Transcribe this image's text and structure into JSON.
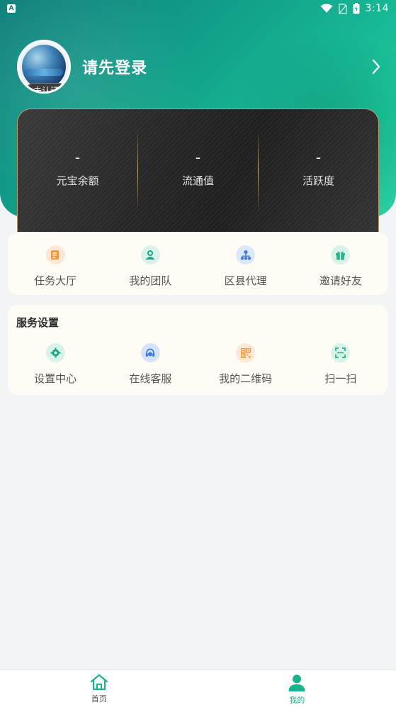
{
  "status_bar": {
    "notification_icon": "A",
    "time": "3:14"
  },
  "profile": {
    "login_prompt": "请先登录",
    "verification_badge": "未认证"
  },
  "stats": [
    {
      "value": "-",
      "label": "元宝余额"
    },
    {
      "value": "-",
      "label": "流通值"
    },
    {
      "value": "-",
      "label": "活跃度"
    }
  ],
  "quick_menu": [
    {
      "label": "任务大厅",
      "icon": "task-icon"
    },
    {
      "label": "我的团队",
      "icon": "team-icon"
    },
    {
      "label": "区县代理",
      "icon": "agent-icon"
    },
    {
      "label": "邀请好友",
      "icon": "gift-icon"
    }
  ],
  "service": {
    "title": "服务设置",
    "items": [
      {
        "label": "设置中心",
        "icon": "settings-icon"
      },
      {
        "label": "在线客服",
        "icon": "headset-icon"
      },
      {
        "label": "我的二维码",
        "icon": "qrcode-icon"
      },
      {
        "label": "扫一扫",
        "icon": "scan-icon"
      }
    ]
  },
  "bottom_nav": [
    {
      "label": "首页",
      "icon": "home-icon",
      "active": false
    },
    {
      "label": "我的",
      "icon": "user-icon",
      "active": true
    }
  ],
  "colors": {
    "accent": "#15b48e",
    "hero_start": "#0e7f7a",
    "hero_end": "#2dd3a5",
    "card_bg": "#fffcf6",
    "gold_border": "#b79a68"
  }
}
